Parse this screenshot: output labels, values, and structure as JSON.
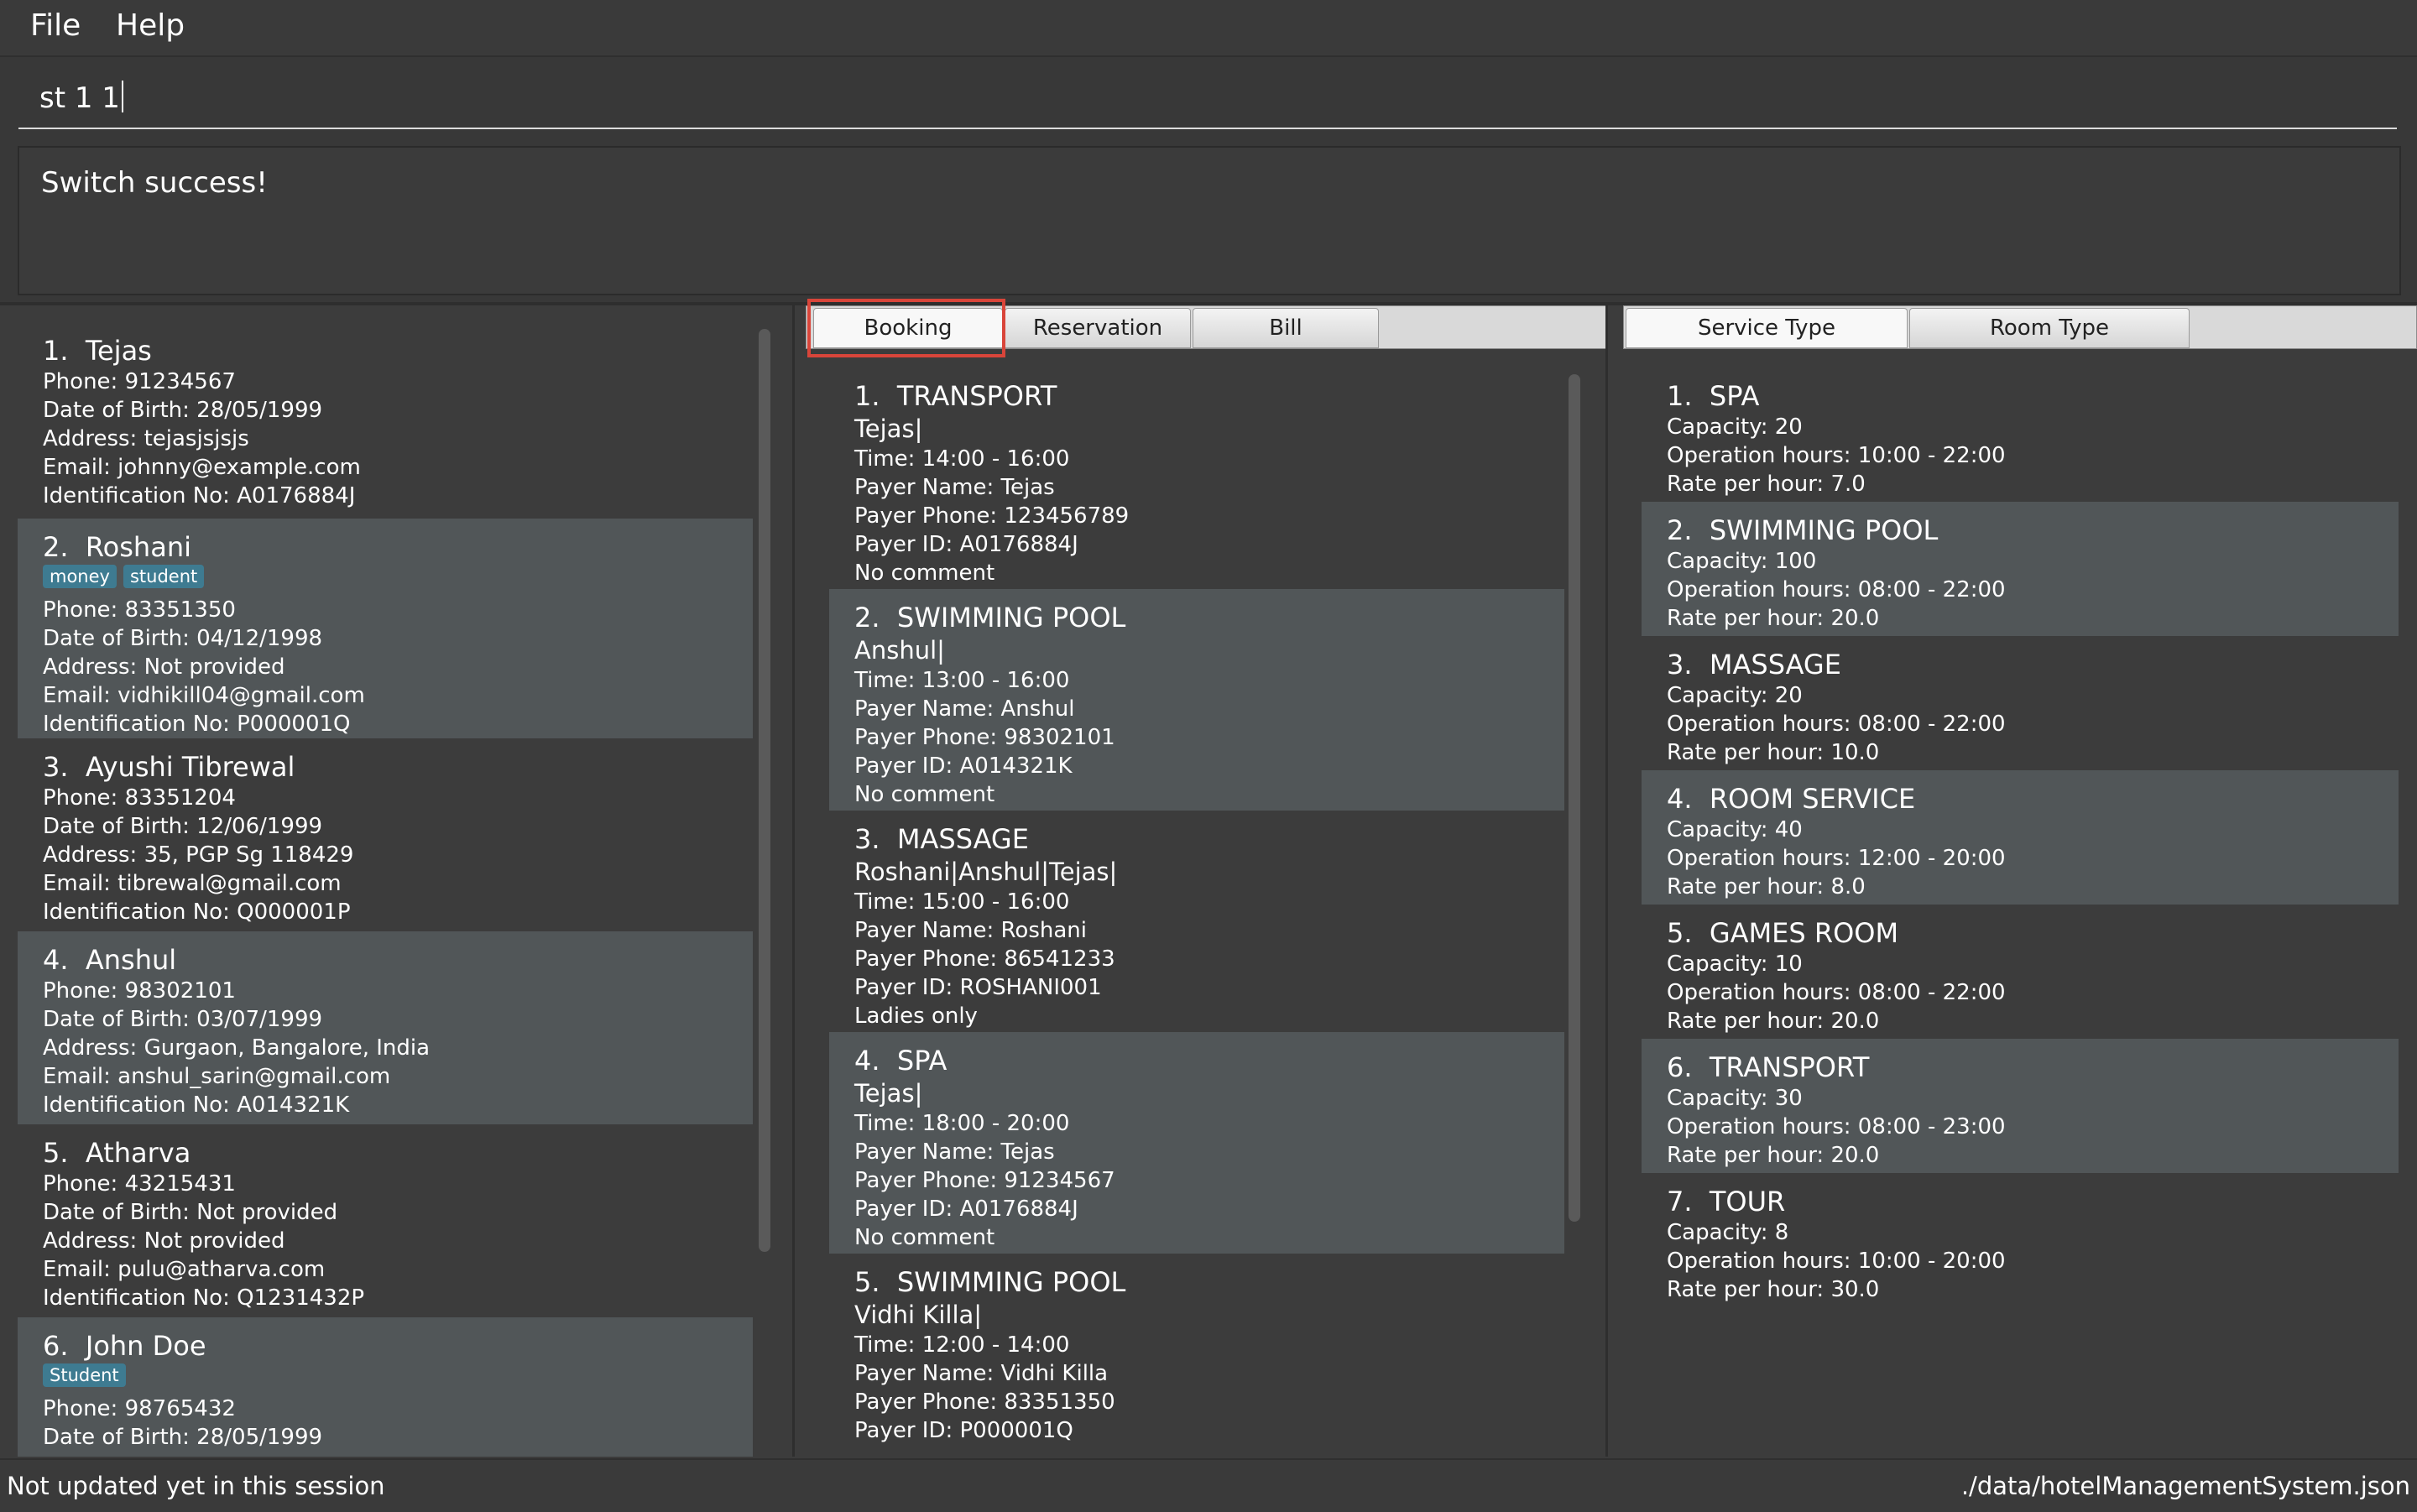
{
  "menu": {
    "file_label": "File",
    "help_label": "Help"
  },
  "command": {
    "value": "st 1 1"
  },
  "result": {
    "message": "Switch success!"
  },
  "guests": [
    {
      "index": "1.",
      "name": "Tejas",
      "tags": [],
      "phone": "Phone: 91234567",
      "dob": "Date of Birth: 28/05/1999",
      "address": "Address: tejasjsjsjs",
      "email": "Email: johnny@example.com",
      "id": "Identification No: A0176884J"
    },
    {
      "index": "2.",
      "name": "Roshani",
      "tags": [
        "money",
        "student"
      ],
      "phone": "Phone: 83351350",
      "dob": "Date of Birth: 04/12/1998",
      "address": "Address: Not provided",
      "email": "Email: vidhikill04@gmail.com",
      "id": "Identification No: P000001Q"
    },
    {
      "index": "3.",
      "name": "Ayushi Tibrewal",
      "tags": [],
      "phone": "Phone: 83351204",
      "dob": "Date of Birth: 12/06/1999",
      "address": "Address: 35, PGP Sg 118429",
      "email": "Email: tibrewal@gmail.com",
      "id": "Identification No: Q000001P"
    },
    {
      "index": "4.",
      "name": "Anshul",
      "tags": [],
      "phone": "Phone: 98302101",
      "dob": "Date of Birth: 03/07/1999",
      "address": "Address: Gurgaon, Bangalore, India",
      "email": "Email: anshul_sarin@gmail.com",
      "id": "Identification No: A014321K"
    },
    {
      "index": "5.",
      "name": "Atharva",
      "tags": [],
      "phone": "Phone: 43215431",
      "dob": "Date of Birth: Not provided",
      "address": "Address: Not provided",
      "email": "Email: pulu@atharva.com",
      "id": "Identification No: Q1231432P"
    },
    {
      "index": "6.",
      "name": "John Doe",
      "tags": [
        "Student"
      ],
      "phone": "Phone: 98765432",
      "dob": "Date of Birth: 28/05/1999",
      "address": "",
      "email": "",
      "id": ""
    }
  ],
  "middle_tabs": {
    "booking": "Booking",
    "reservation": "Reservation",
    "bill": "Bill"
  },
  "bookings": [
    {
      "index": "1.",
      "service": "TRANSPORT",
      "guests": "Tejas|",
      "time": "Time: 14:00 - 16:00",
      "payer_name": "Payer Name: Tejas",
      "payer_phone": "Payer Phone: 123456789",
      "payer_id": "Payer ID: A0176884J",
      "comment": "No comment"
    },
    {
      "index": "2.",
      "service": "SWIMMING POOL",
      "guests": "Anshul|",
      "time": "Time: 13:00 - 16:00",
      "payer_name": "Payer Name: Anshul",
      "payer_phone": "Payer Phone: 98302101",
      "payer_id": "Payer ID: A014321K",
      "comment": "No comment"
    },
    {
      "index": "3.",
      "service": "MASSAGE",
      "guests": "Roshani|Anshul|Tejas|",
      "time": "Time: 15:00 - 16:00",
      "payer_name": "Payer Name: Roshani",
      "payer_phone": "Payer Phone: 86541233",
      "payer_id": "Payer ID: ROSHANI001",
      "comment": "Ladies only"
    },
    {
      "index": "4.",
      "service": "SPA",
      "guests": "Tejas|",
      "time": "Time: 18:00 - 20:00",
      "payer_name": "Payer Name: Tejas",
      "payer_phone": "Payer Phone: 91234567",
      "payer_id": "Payer ID: A0176884J",
      "comment": "No comment"
    },
    {
      "index": "5.",
      "service": "SWIMMING POOL",
      "guests": "Vidhi Killa|",
      "time": "Time: 12:00 - 14:00",
      "payer_name": "Payer Name: Vidhi Killa",
      "payer_phone": "Payer Phone: 83351350",
      "payer_id": "Payer ID: P000001Q",
      "comment": ""
    }
  ],
  "right_tabs": {
    "service_type": "Service Type",
    "room_type": "Room Type"
  },
  "services": [
    {
      "index": "1.",
      "name": "SPA",
      "capacity": "Capacity: 20",
      "hours": "Operation hours: 10:00 - 22:00",
      "rate": "Rate per hour: 7.0"
    },
    {
      "index": "2.",
      "name": "SWIMMING POOL",
      "capacity": "Capacity: 100",
      "hours": "Operation hours: 08:00 - 22:00",
      "rate": "Rate per hour: 20.0"
    },
    {
      "index": "3.",
      "name": "MASSAGE",
      "capacity": "Capacity: 20",
      "hours": "Operation hours: 08:00 - 22:00",
      "rate": "Rate per hour: 10.0"
    },
    {
      "index": "4.",
      "name": "ROOM SERVICE",
      "capacity": "Capacity: 40",
      "hours": "Operation hours: 12:00 - 20:00",
      "rate": "Rate per hour: 8.0"
    },
    {
      "index": "5.",
      "name": "GAMES ROOM",
      "capacity": "Capacity: 10",
      "hours": "Operation hours: 08:00 - 22:00",
      "rate": "Rate per hour: 20.0"
    },
    {
      "index": "6.",
      "name": "TRANSPORT",
      "capacity": "Capacity: 30",
      "hours": "Operation hours: 08:00 - 23:00",
      "rate": "Rate per hour: 20.0"
    },
    {
      "index": "7.",
      "name": "TOUR",
      "capacity": "Capacity: 8",
      "hours": "Operation hours: 10:00 - 20:00",
      "rate": "Rate per hour: 30.0"
    }
  ],
  "status": {
    "left": "Not updated yet in this session",
    "right": "./data/hotelManagementSystem.json"
  },
  "colors": {
    "background": "#3c3c3c",
    "card_alt": "#515658",
    "tag": "#3e7b91",
    "tab_highlight": "#d9453a"
  }
}
